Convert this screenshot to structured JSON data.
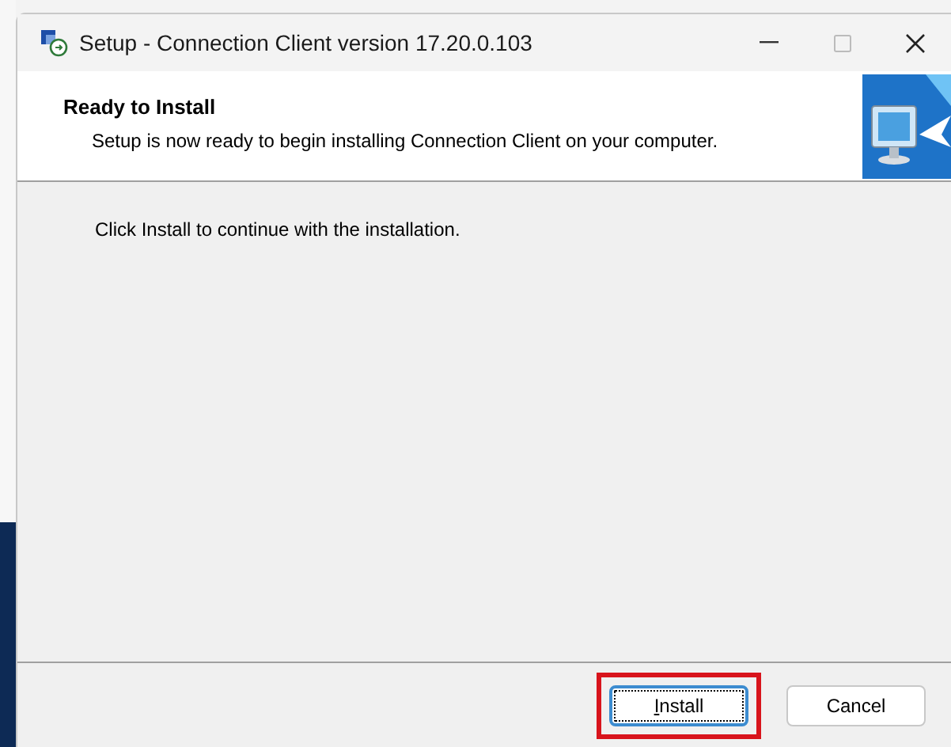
{
  "window": {
    "title": "Setup - Connection Client version 17.20.0.103"
  },
  "header": {
    "title": "Ready to Install",
    "subtitle": "Setup is now ready to begin installing Connection Client on your computer."
  },
  "body": {
    "text": "Click Install to continue with the installation."
  },
  "buttons": [
    {
      "label": "Install",
      "focused": true,
      "highlighted": true,
      "accelerator_underlined": true
    },
    {
      "label": "Cancel",
      "focused": false,
      "highlighted": false,
      "accelerator_underlined": false
    }
  ]
}
